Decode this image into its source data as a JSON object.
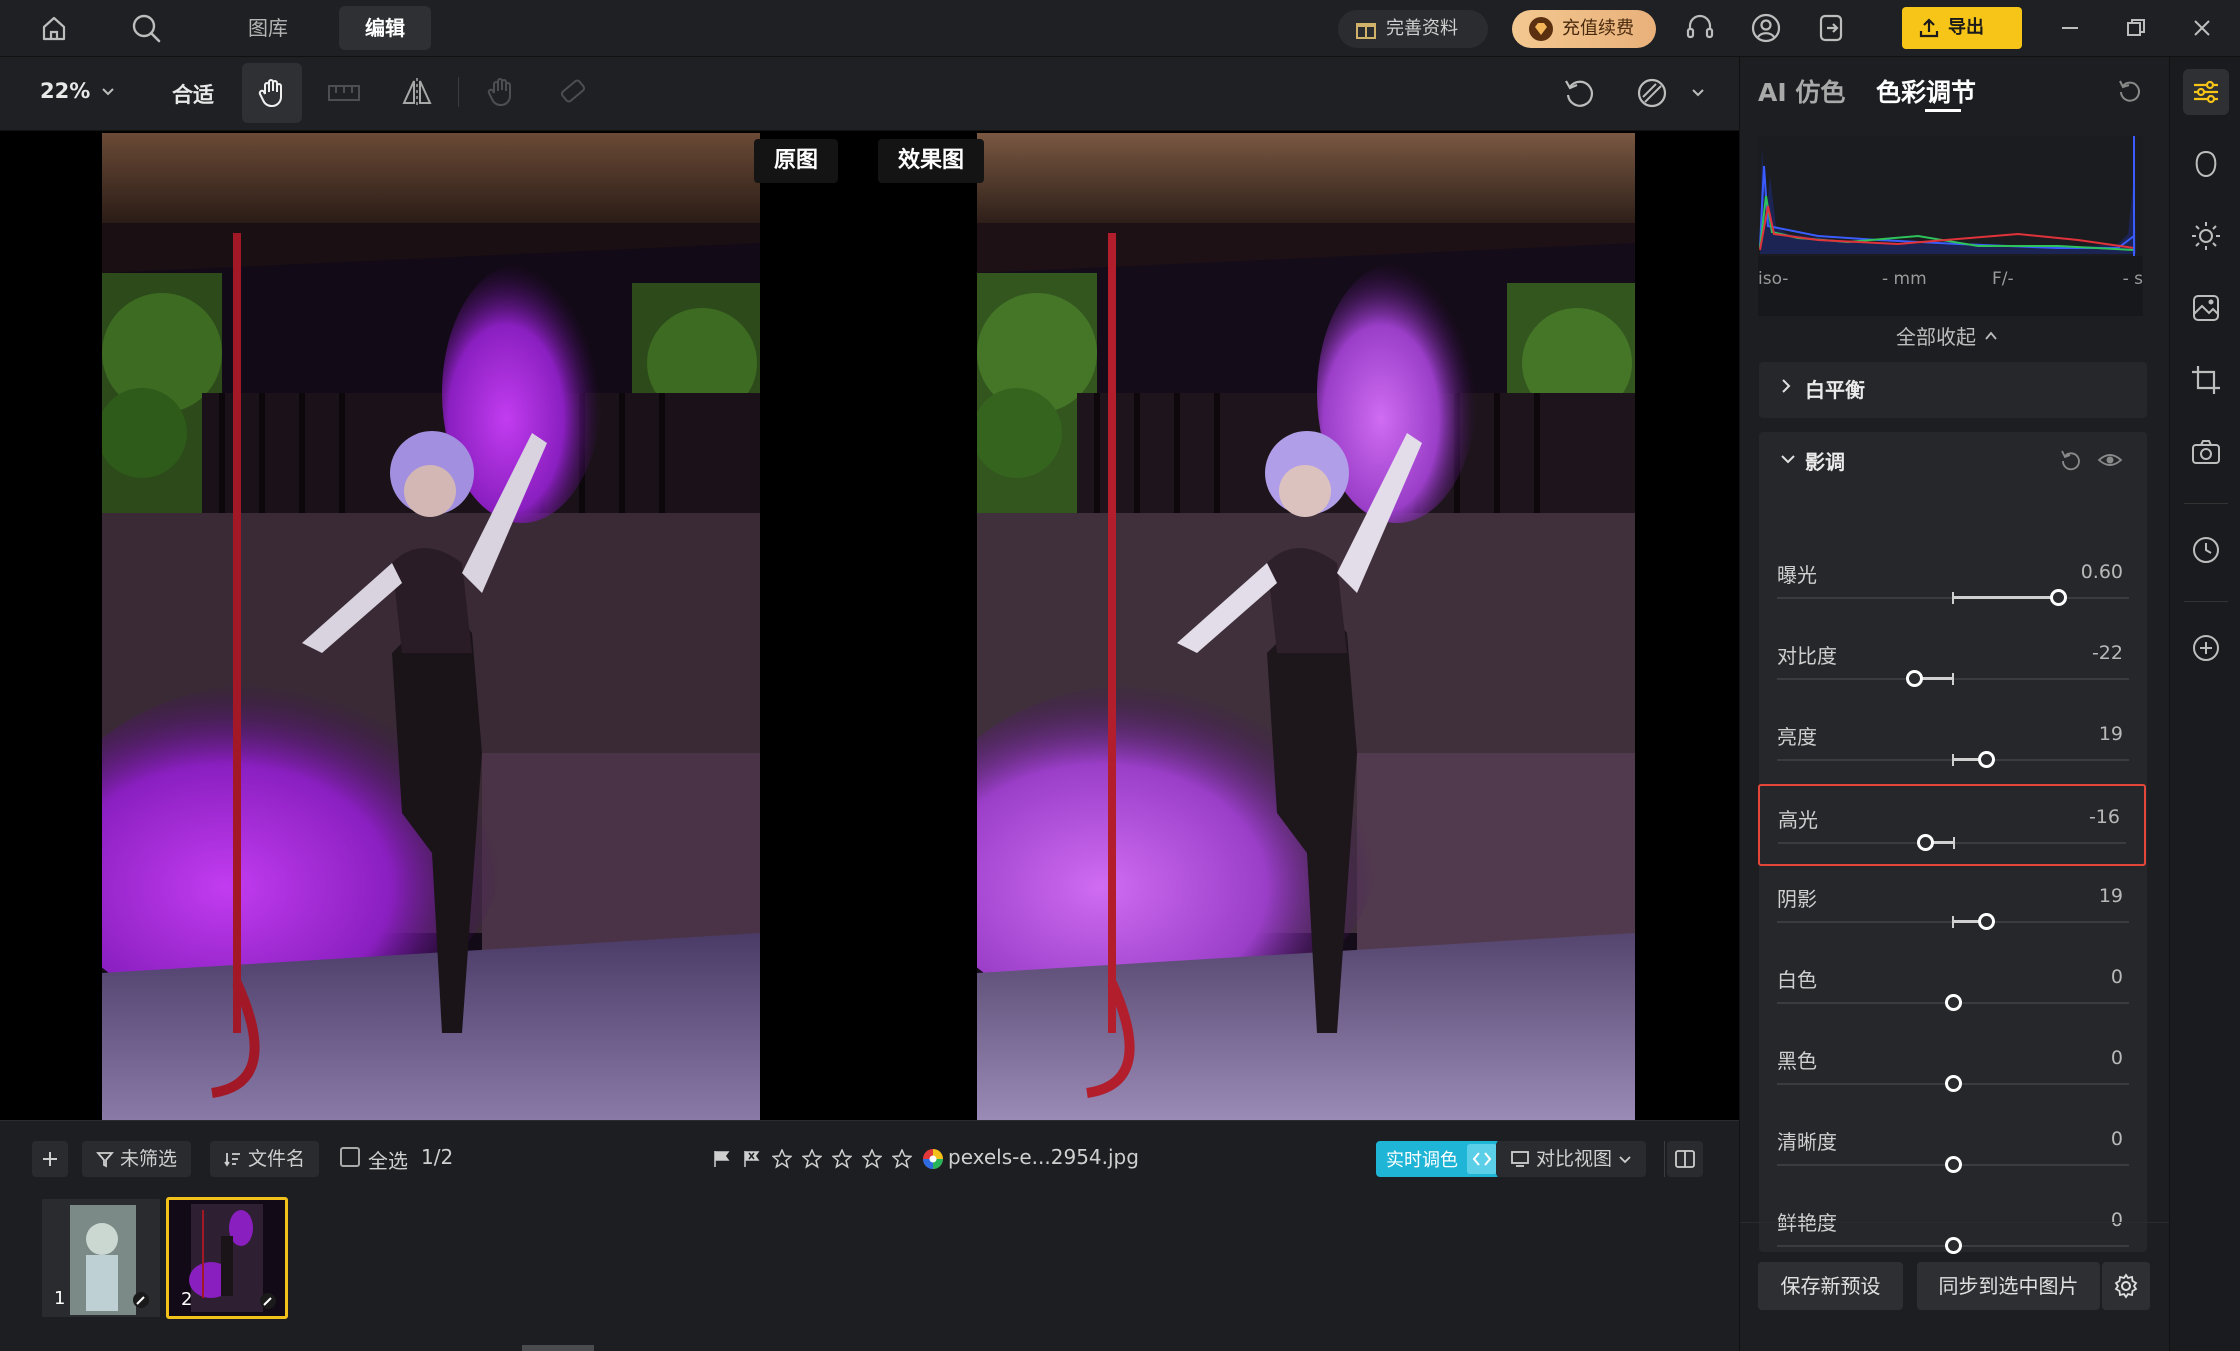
{
  "topbar": {
    "tabs": [
      {
        "label": "图库"
      },
      {
        "label": "编辑"
      }
    ],
    "complete_profile": "完善资料",
    "recharge": "充值续费",
    "export": "导出"
  },
  "toolbar": {
    "zoom": "22%",
    "fit": "合适"
  },
  "canvas": {
    "original_label": "原图",
    "effect_label": "效果图"
  },
  "filmstrip": {
    "filter": "未筛选",
    "sort": "文件名",
    "select_all": "全选",
    "selection_count": "1/2",
    "filename": "pexels-e...2954.jpg",
    "live_adjust": "实时调色",
    "compare_view": "对比视图",
    "thumbs": [
      {
        "index": "1"
      },
      {
        "index": "2"
      }
    ]
  },
  "panel": {
    "tabs": [
      {
        "label": "AI 仿色"
      },
      {
        "label": "色彩调节"
      }
    ],
    "exif": {
      "iso": "iso-",
      "mm": "- mm",
      "f": "F/-",
      "s": "- s"
    },
    "collapse_all": "全部收起",
    "white_balance": "白平衡",
    "tone": "影调",
    "sliders": [
      {
        "label": "曝光",
        "value": "0.60",
        "position": 0.6
      },
      {
        "label": "对比度",
        "value": "-22",
        "position": -0.22
      },
      {
        "label": "亮度",
        "value": "19",
        "position": 0.19
      },
      {
        "label": "高光",
        "value": "-16",
        "position": -0.16
      },
      {
        "label": "阴影",
        "value": "19",
        "position": 0.19
      },
      {
        "label": "白色",
        "value": "0",
        "position": 0
      },
      {
        "label": "黑色",
        "value": "0",
        "position": 0
      },
      {
        "label": "清晰度",
        "value": "0",
        "position": 0
      },
      {
        "label": "鲜艳度",
        "value": "0",
        "position": 0
      }
    ],
    "save_preset": "保存新预设",
    "sync": "同步到选中图片"
  },
  "colors": {
    "accent": "#f7c518",
    "highlight_border": "#e4473a",
    "live_adjust": "#1fb5d6",
    "selected_thumb": "#f2c21b"
  }
}
